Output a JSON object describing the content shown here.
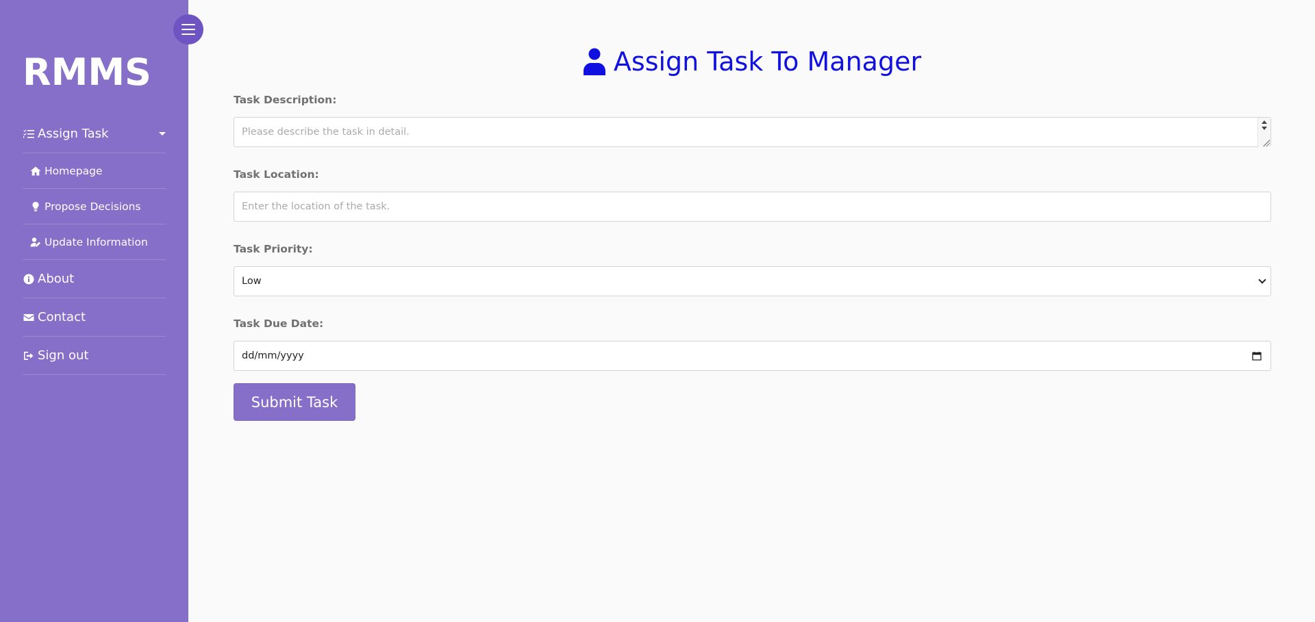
{
  "brand": "RMMS",
  "sidebar": {
    "items": [
      {
        "label": "Assign Task",
        "icon": "tasks-checklist-icon"
      },
      {
        "label": "Homepage",
        "icon": "home-icon"
      },
      {
        "label": "Propose Decisions",
        "icon": "lightbulb-icon"
      },
      {
        "label": "Update Information",
        "icon": "user-edit-icon"
      },
      {
        "label": "About",
        "icon": "info-circle-icon"
      },
      {
        "label": "Contact",
        "icon": "envelope-icon"
      },
      {
        "label": "Sign out",
        "icon": "sign-out-icon"
      }
    ]
  },
  "main": {
    "title": "Assign Task To Manager",
    "title_icon": "user-tie-icon",
    "form": {
      "description": {
        "label": "Task Description:",
        "placeholder": "Please describe the task in detail."
      },
      "location": {
        "label": "Task Location:",
        "placeholder": "Enter the location of the task."
      },
      "priority": {
        "label": "Task Priority:",
        "value": "Low"
      },
      "due_date": {
        "label": "Task Due Date:",
        "value": "dd/mm/yyyy"
      },
      "submit_label": "Submit Task"
    }
  },
  "colors": {
    "sidebar_bg": "#866fc9",
    "toggle_bg": "#6d54c2",
    "title": "#1010e0",
    "page_bg": "#fafafa"
  }
}
